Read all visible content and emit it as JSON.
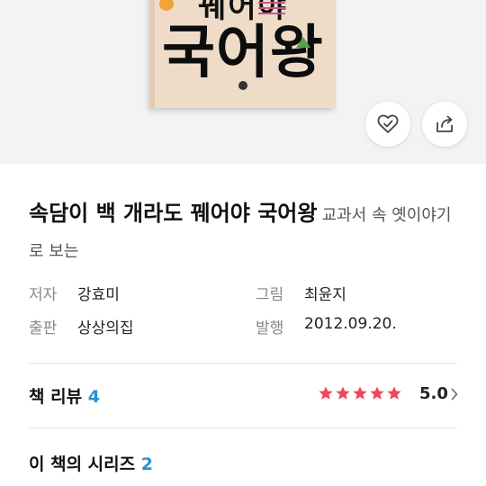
{
  "cover": {
    "subtitle": "꿰어야",
    "main_title": "국어왕"
  },
  "actions": {
    "like_icon": "heart-check-icon",
    "share_icon": "share-icon"
  },
  "book": {
    "title": "속담이 백 개라도 꿰어야 국어왕",
    "subtitle": "교과서 속 옛이야기로 보는"
  },
  "meta": {
    "author_label": "저자",
    "author": "강효미",
    "illustrator_label": "그림",
    "illustrator": "최윤지",
    "publisher_label": "출판",
    "publisher": "상상의집",
    "date_label": "발행",
    "date": "2012.09.20."
  },
  "reviews": {
    "label": "책 리뷰",
    "count": "4",
    "stars": 5,
    "rating": "5.0",
    "star_color": "#f0465a"
  },
  "series": {
    "label": "이 책의 시리즈",
    "count": "2"
  }
}
